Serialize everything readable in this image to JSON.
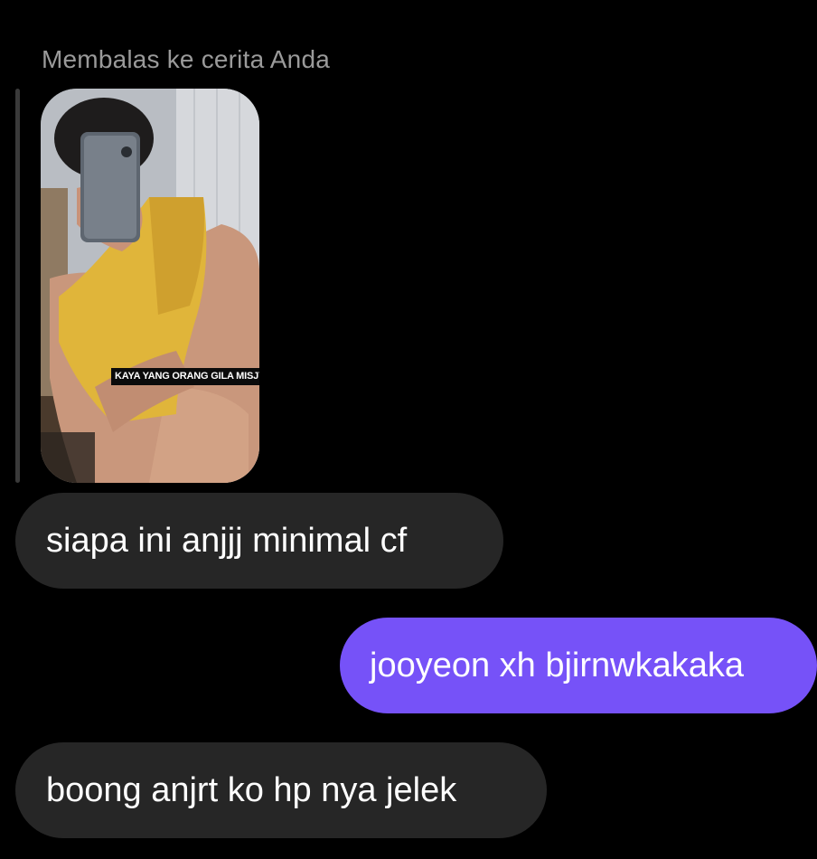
{
  "reply_header": {
    "caption": "Membalas ke cerita Anda"
  },
  "story": {
    "caption_text": "KAYA YANG ORANG GILA MISJYSTE"
  },
  "messages": [
    {
      "direction": "incoming",
      "text": "siapa ini anjjj minimal cf"
    },
    {
      "direction": "outgoing",
      "text": "jooyeon xh bjirnwkakaka"
    },
    {
      "direction": "incoming",
      "text": "boong anjrt ko hp nya jelek"
    }
  ],
  "colors": {
    "background": "#000000",
    "incoming_bubble": "#262626",
    "outgoing_bubble": "#7652f8",
    "caption_text": "#9a9a9a"
  }
}
